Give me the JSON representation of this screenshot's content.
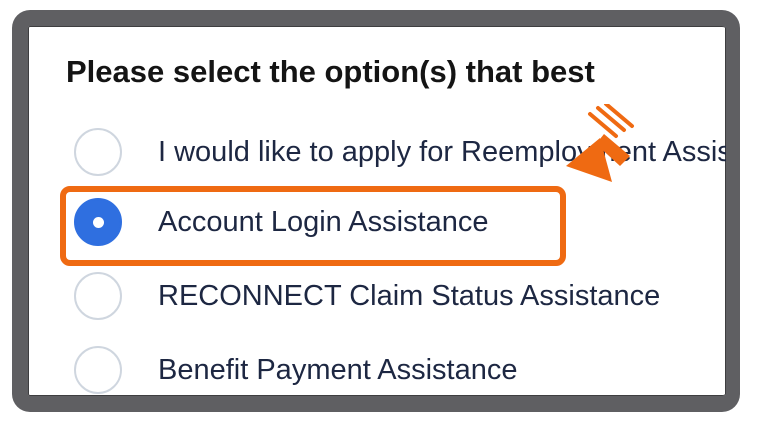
{
  "question": {
    "title": "Please select the option(s) that best"
  },
  "options": [
    {
      "label": "I would like to apply for Reemployment Assistance",
      "selected": false
    },
    {
      "label": "Account Login Assistance",
      "selected": true
    },
    {
      "label": "RECONNECT Claim Status Assistance",
      "selected": false
    },
    {
      "label": "Benefit Payment Assistance",
      "selected": false
    }
  ],
  "colors": {
    "frame": "#5f5f62",
    "radio_selected": "#2f6fe0",
    "radio_border": "#cfd6df",
    "highlight": "#ef6a12",
    "label_text": "#1d2742",
    "title_text": "#141414"
  },
  "annotation": {
    "icon": "arrow-pointer-icon"
  }
}
